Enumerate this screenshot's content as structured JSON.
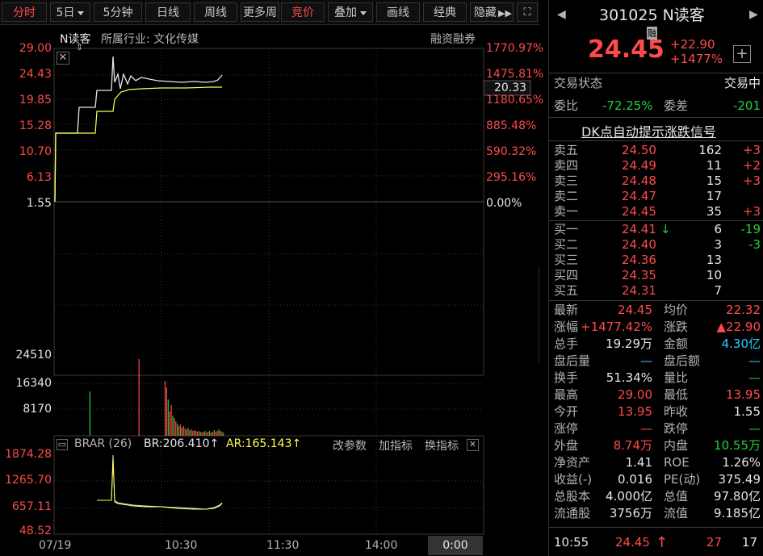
{
  "tabs": [
    {
      "label": "分时",
      "state": "active"
    },
    {
      "label": "5日",
      "state": "dropdown"
    },
    {
      "label": "5分钟",
      "state": "normal"
    },
    {
      "label": "日线",
      "state": "normal"
    },
    {
      "label": "周线",
      "state": "normal"
    },
    {
      "label": "更多周",
      "state": "normal"
    },
    {
      "label": "竞价",
      "state": "red"
    },
    {
      "label": "叠加",
      "state": "dropdown"
    },
    {
      "label": "画线",
      "state": "normal"
    },
    {
      "label": "经典",
      "state": "normal"
    },
    {
      "label": "隐藏",
      "state": "normal"
    }
  ],
  "chart_header": {
    "name": "N读客",
    "industry": "所属行业: 文化传媒",
    "margin": "融资融券"
  },
  "price_axis_left": [
    "29.00",
    "24.43",
    "19.85",
    "15.28",
    "10.70",
    "6.13",
    "1.55"
  ],
  "price_axis_right": [
    "1770.97%",
    "1475.81%",
    "1180.65%",
    "885.48%",
    "590.32%",
    "295.16%",
    "0.00%"
  ],
  "crosshair_value": "20.33",
  "volume_axis": [
    "24510",
    "16340",
    "8170"
  ],
  "indicator_bar": {
    "name": "BRAR (26)",
    "br": "BR:206.410↑",
    "ar": "AR:165.143↑",
    "edit": "改参数",
    "add": "加指标",
    "switch": "换指标"
  },
  "indicator_axis": [
    "1874.28",
    "1265.70",
    "657.11",
    "48.52"
  ],
  "time_axis": [
    "07/19",
    "10:30",
    "11:30",
    "14:00",
    "0:00"
  ],
  "chart_data": {
    "type": "line",
    "series": [
      {
        "name": "price",
        "x": [
          "09:30",
          "09:31",
          "09:46",
          "09:50",
          "10:00",
          "10:10",
          "10:20",
          "10:30",
          "10:40",
          "10:50",
          "10:55"
        ],
        "values": [
          1.55,
          13.95,
          17.0,
          23.5,
          24.0,
          24.5,
          24.3,
          24.1,
          24.0,
          24.1,
          24.45
        ]
      },
      {
        "name": "average",
        "x": [
          "09:30",
          "09:31",
          "09:46",
          "09:50",
          "10:00",
          "10:10",
          "10:20",
          "10:30",
          "10:40",
          "10:50",
          "10:55"
        ],
        "values": [
          1.55,
          13.95,
          15.5,
          20.0,
          21.5,
          22.0,
          22.2,
          22.25,
          22.3,
          22.3,
          22.32
        ]
      }
    ],
    "ylim": [
      1.55,
      29.0
    ]
  },
  "panel": {
    "code_name": "301025 N读客",
    "margin_tag": "融",
    "price": "24.45",
    "change": "+22.90",
    "change_pct": "+1477%",
    "trade_status_label": "交易状态",
    "trade_status": "交易中",
    "weibi_label": "委比",
    "weibi": "-72.25%",
    "weicha_label": "委差",
    "weicha": "-201",
    "dk_title": "DK点自动提示涨跌信号",
    "asks": [
      {
        "label": "卖五",
        "price": "24.50",
        "vol": "162",
        "chg": "+3"
      },
      {
        "label": "卖四",
        "price": "24.49",
        "vol": "11",
        "chg": "+2"
      },
      {
        "label": "卖三",
        "price": "24.48",
        "vol": "15",
        "chg": "+3"
      },
      {
        "label": "卖二",
        "price": "24.47",
        "vol": "17",
        "chg": ""
      },
      {
        "label": "卖一",
        "price": "24.45",
        "vol": "35",
        "chg": "+3"
      }
    ],
    "bids": [
      {
        "label": "买一",
        "price": "24.41",
        "vol": "6",
        "chg": "-19"
      },
      {
        "label": "买二",
        "price": "24.40",
        "vol": "3",
        "chg": "-3"
      },
      {
        "label": "买三",
        "price": "24.36",
        "vol": "13",
        "chg": ""
      },
      {
        "label": "买四",
        "price": "24.35",
        "vol": "10",
        "chg": ""
      },
      {
        "label": "买五",
        "price": "24.31",
        "vol": "7",
        "chg": ""
      }
    ],
    "stats": [
      {
        "l1": "最新",
        "v1": "24.45",
        "c1": "red",
        "l2": "均价",
        "v2": "22.32",
        "c2": "red"
      },
      {
        "l1": "涨幅",
        "v1": "+1477.42%",
        "c1": "red",
        "l2": "涨跌",
        "v2": "▲22.90",
        "c2": "red"
      },
      {
        "l1": "总手",
        "v1": "19.29万",
        "c1": "white",
        "l2": "金额",
        "v2": "4.30亿",
        "c2": "cyan"
      },
      {
        "l1": "盘后量",
        "v1": "—",
        "c1": "cyan",
        "l2": "盘后额",
        "v2": "—",
        "c2": "cyan"
      },
      {
        "l1": "换手",
        "v1": "51.34%",
        "c1": "white",
        "l2": "量比",
        "v2": "—",
        "c2": "green"
      },
      {
        "l1": "最高",
        "v1": "29.00",
        "c1": "red",
        "l2": "最低",
        "v2": "13.95",
        "c2": "red"
      },
      {
        "l1": "今开",
        "v1": "13.95",
        "c1": "red",
        "l2": "昨收",
        "v2": "1.55",
        "c2": "white"
      },
      {
        "l1": "涨停",
        "v1": "—",
        "c1": "red",
        "l2": "跌停",
        "v2": "—",
        "c2": "green"
      },
      {
        "l1": "外盘",
        "v1": "8.74万",
        "c1": "red",
        "l2": "内盘",
        "v2": "10.55万",
        "c2": "green"
      },
      {
        "l1": "净资产",
        "v1": "1.41",
        "c1": "white",
        "l2": "ROE",
        "v2": "1.26%",
        "c2": "white"
      },
      {
        "l1": "收益(-)",
        "v1": "0.016",
        "c1": "white",
        "l2": "PE(动)",
        "v2": "375.49",
        "c2": "white"
      },
      {
        "l1": "总股本",
        "v1": "4.000亿",
        "c1": "white",
        "l2": "总值",
        "v2": "97.80亿",
        "c2": "white"
      },
      {
        "l1": "流通股",
        "v1": "3756万",
        "c1": "white",
        "l2": "流值",
        "v2": "9.185亿",
        "c2": "white"
      }
    ],
    "tick": {
      "time": "10:55",
      "price": "24.45",
      "vol": "27",
      "count": "17"
    }
  }
}
